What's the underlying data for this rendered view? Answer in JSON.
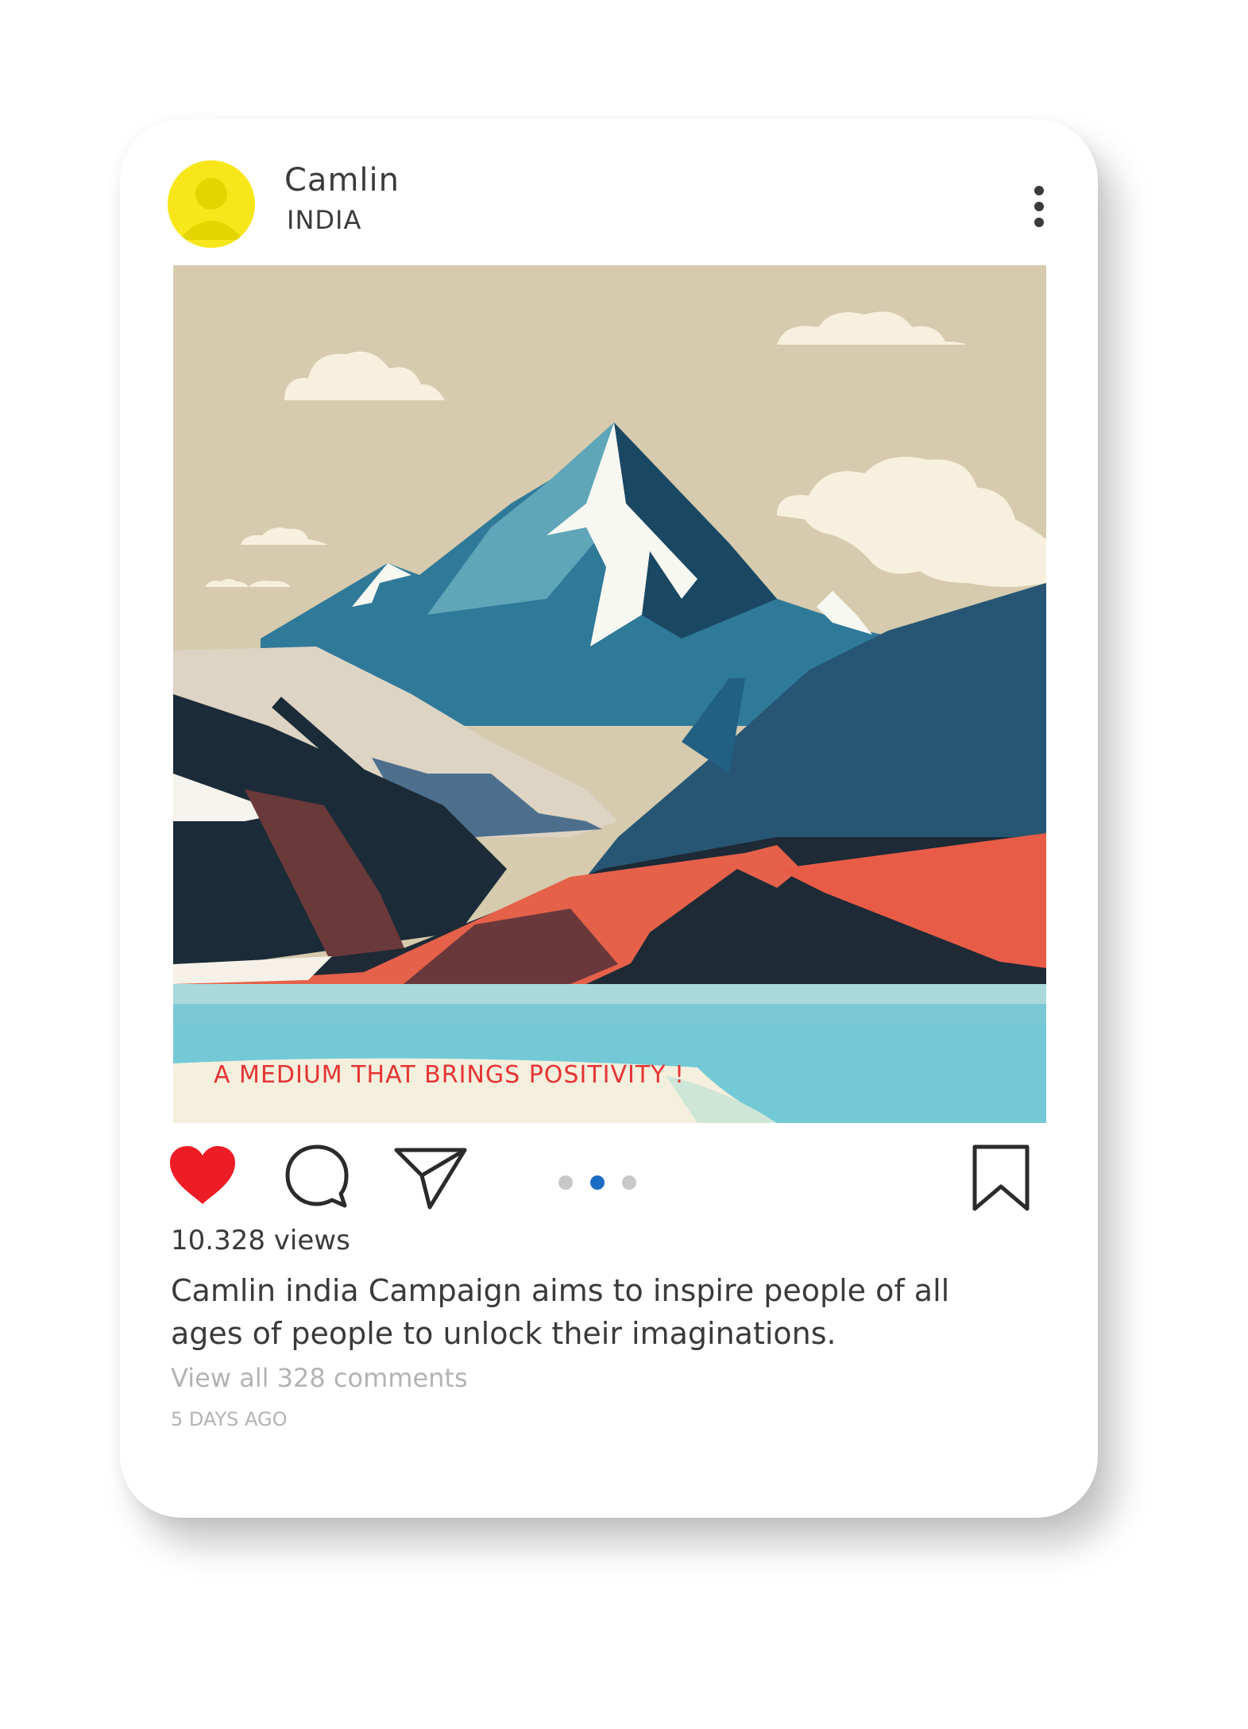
{
  "post": {
    "username": "Camlin",
    "location": "INDIA",
    "image_caption": "A MEDIUM THAT BRINGS POSITIVITY !",
    "views": "10.328 views",
    "description": "Camlin india Campaign aims to inspire people of all ages of people to unlock their imaginations.",
    "comments_link": "View all 328 comments",
    "timestamp": "5 DAYS AGO",
    "carousel": {
      "total": 3,
      "active_index": 2
    }
  },
  "icons": {
    "avatar": "user-avatar-icon",
    "more": "more-vertical-icon",
    "like": "heart-icon",
    "comment": "comment-bubble-icon",
    "share": "paper-plane-icon",
    "save": "bookmark-icon"
  },
  "colors": {
    "avatar": "#f7e71a",
    "like": "#ee1c25",
    "active_dot": "#1b6cc4",
    "caption_overlay": "#e63434"
  }
}
